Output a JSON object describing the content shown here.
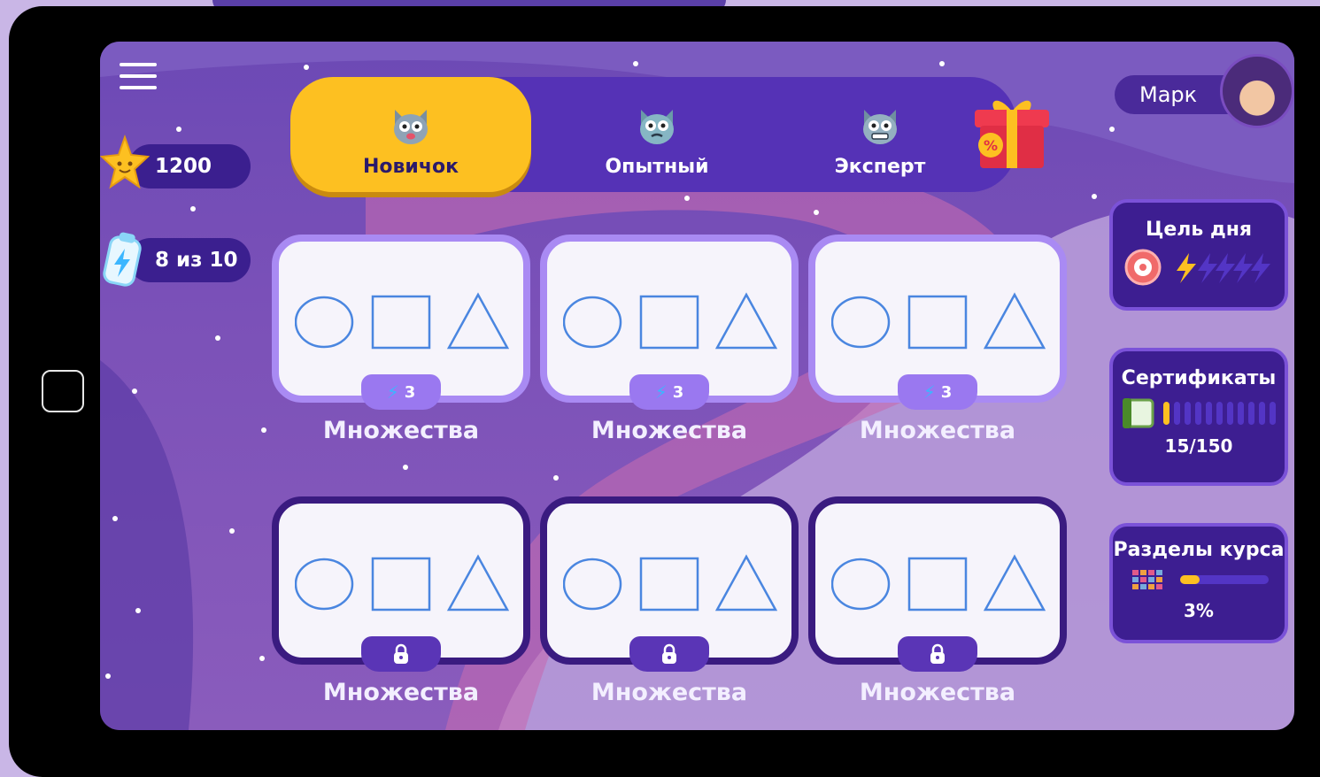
{
  "colors": {
    "screen_bg": "#6c49b5",
    "accent_yellow": "#fdc021",
    "panel_purple": "#3d1e91",
    "card_border_open": "#a98af3",
    "card_border_locked": "#3a1b80",
    "energy_blue": "#3bb6ff"
  },
  "header": {
    "menu_icon": "hamburger-menu-icon",
    "stars": "1200",
    "energy": "8 из 10"
  },
  "levels": [
    {
      "label": "Новичок",
      "icon": "cat-icon",
      "active": true
    },
    {
      "label": "Опытный",
      "icon": "cat-icon",
      "active": false
    },
    {
      "label": "Эксперт",
      "icon": "cat-icon",
      "active": false
    }
  ],
  "profile": {
    "name": "Марк"
  },
  "daily_goal": {
    "title": "Цель дня"
  },
  "certificates": {
    "title": "Сертификаты",
    "progress": "15/150",
    "value": 15,
    "total": 150
  },
  "course_sections": {
    "title": "Разделы курса",
    "percent": "3%",
    "value": 0.03
  },
  "lessons": [
    {
      "label": "Множества",
      "state": "open",
      "cost": "3"
    },
    {
      "label": "Множества",
      "state": "open",
      "cost": "3"
    },
    {
      "label": "Множества",
      "state": "open",
      "cost": "3"
    },
    {
      "label": "Множества",
      "state": "locked"
    },
    {
      "label": "Множества",
      "state": "locked"
    },
    {
      "label": "Множества",
      "state": "locked"
    }
  ]
}
